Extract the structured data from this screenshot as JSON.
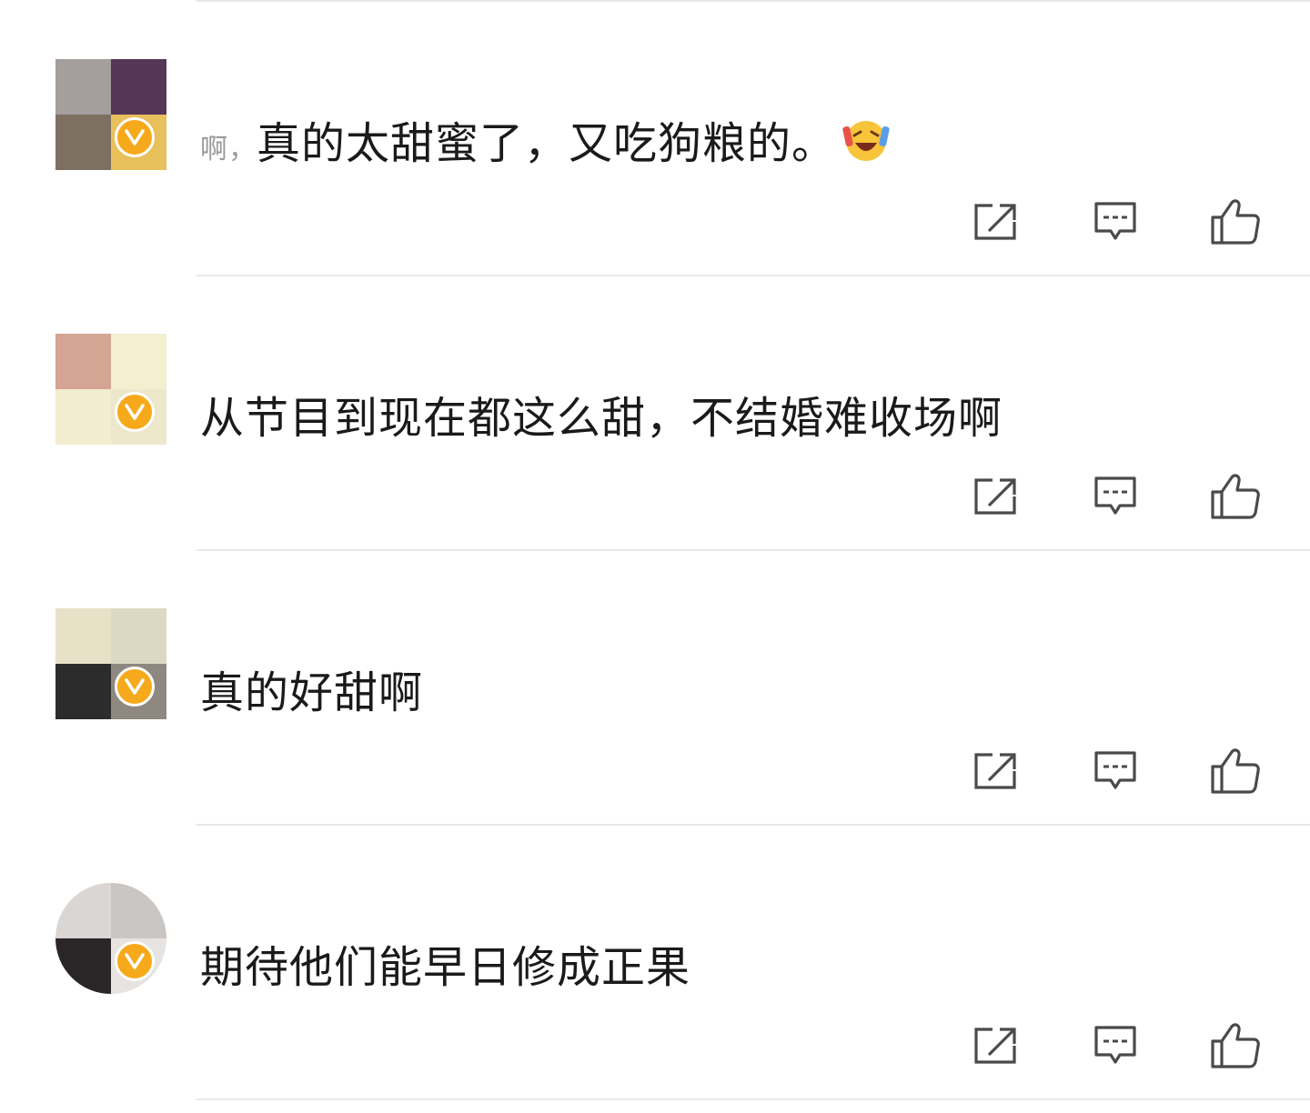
{
  "comments": [
    {
      "prefix": "啊，",
      "text": "真的太甜蜜了，又吃狗粮的。",
      "emoji": "laughing-tears-emoji",
      "verified": true,
      "avatar_colors": [
        "#a49e9c",
        "#563657",
        "#7e6f63",
        "#e8c05c"
      ]
    },
    {
      "prefix": "",
      "text": "从节目到现在都这么甜，不结婚难收场啊",
      "emoji": "",
      "verified": true,
      "avatar_colors": [
        "#d4a592",
        "#f3efcf",
        "#f2edd0",
        "#ede7cc"
      ]
    },
    {
      "prefix": "",
      "text": "真的好甜啊",
      "emoji": "",
      "verified": true,
      "avatar_colors": [
        "#e7e1c8",
        "#ddd8c1",
        "#2c2c2c",
        "#8e8880"
      ]
    },
    {
      "prefix": "",
      "text": "期待他们能早日修成正果",
      "emoji": "",
      "verified": true,
      "avatar_colors": [
        "#d9d6d4",
        "#c9c6c4",
        "#2a2526",
        "#e6e3e1"
      ]
    }
  ],
  "icons": {
    "share": "share-icon",
    "reply": "comment-icon",
    "like": "thumbs-up-icon",
    "badge": "verified-v-icon"
  },
  "colors": {
    "badge": "#f6a91b",
    "icon_stroke": "#4a4a4a",
    "text": "#1a1a1a",
    "divider": "#e9e9e9"
  }
}
